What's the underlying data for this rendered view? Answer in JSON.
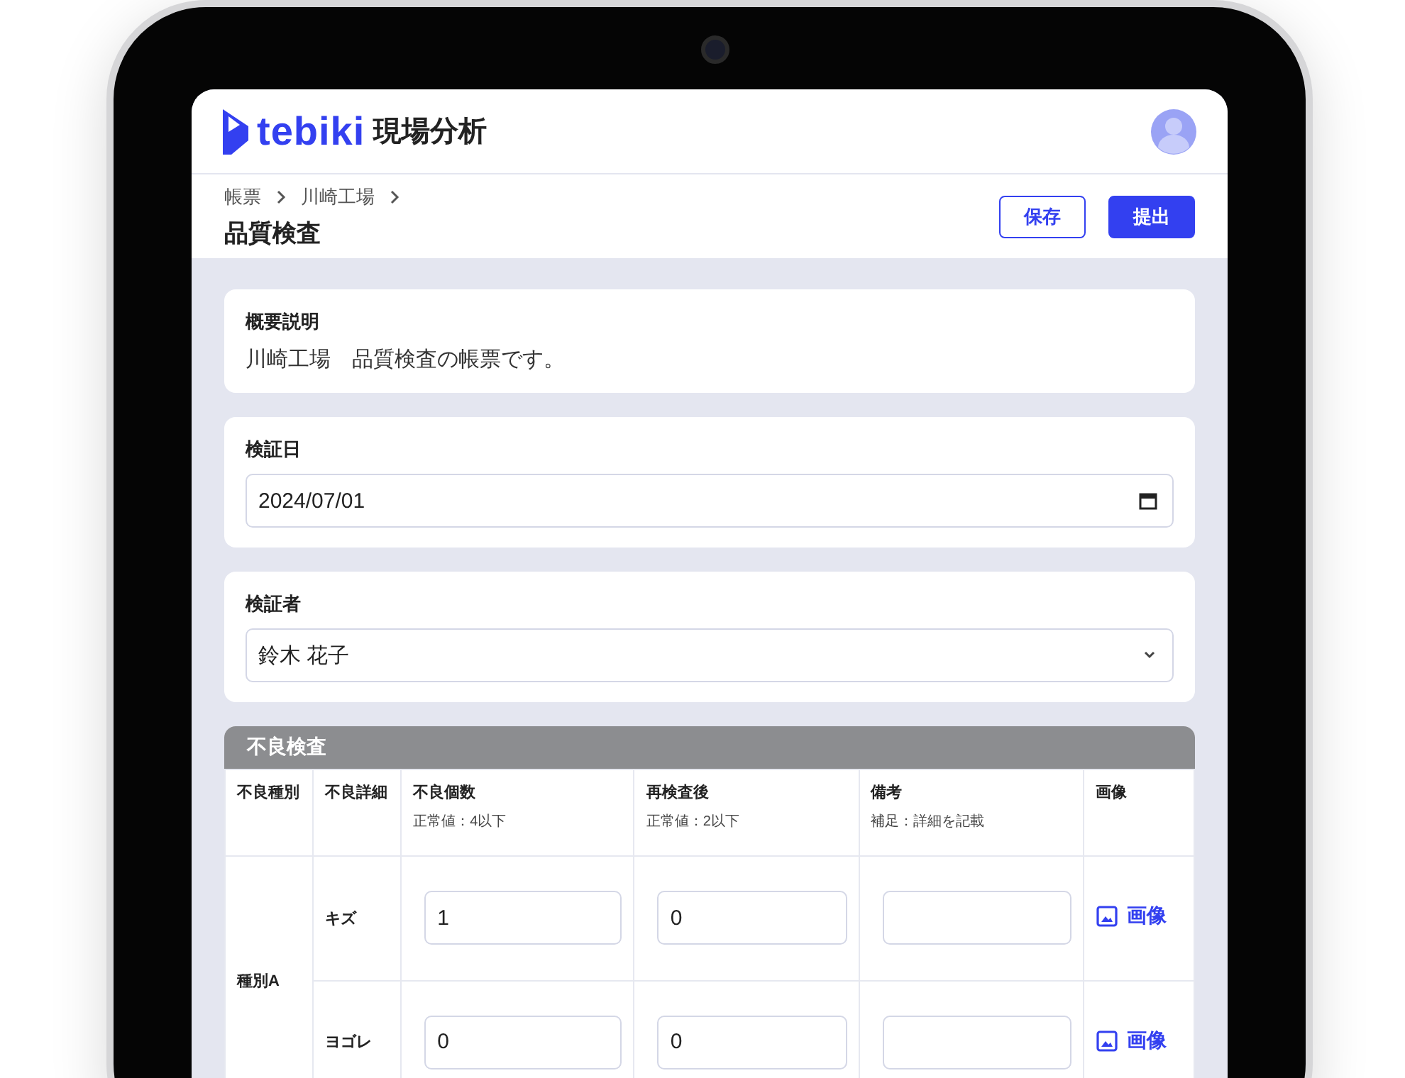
{
  "app": {
    "logo_text": "tebiki",
    "product": "現場分析"
  },
  "breadcrumb": [
    "帳票",
    "川崎工場"
  ],
  "title": "品質検査",
  "actions": [
    {
      "label": "保存",
      "kind": "outline"
    },
    {
      "label": "提出",
      "kind": "primary"
    }
  ],
  "fields": [
    {
      "kind": "text",
      "label": "概要説明",
      "value": "川崎工場　品質検査の帳票です。"
    },
    {
      "kind": "date",
      "label": "検証日",
      "value": "2024/07/01"
    },
    {
      "kind": "select",
      "label": "検証者",
      "value": "鈴木 花子"
    }
  ],
  "table": {
    "title": "不良検査",
    "columns": [
      {
        "label": "不良種別"
      },
      {
        "label": "不良詳細"
      },
      {
        "label": "不良個数",
        "note": "正常値：4以下"
      },
      {
        "label": "再検査後",
        "note": "正常値：2以下"
      },
      {
        "label": "備考",
        "note": "補足：詳細を記載"
      },
      {
        "label": "画像"
      }
    ],
    "groups": [
      {
        "type": "種別A",
        "rows": [
          {
            "detail": "キズ",
            "count": "1",
            "recheck": "0",
            "image_label": "画像"
          },
          {
            "detail": "ヨゴレ",
            "count": "0",
            "recheck": "0",
            "image_label": "画像"
          }
        ]
      }
    ]
  }
}
